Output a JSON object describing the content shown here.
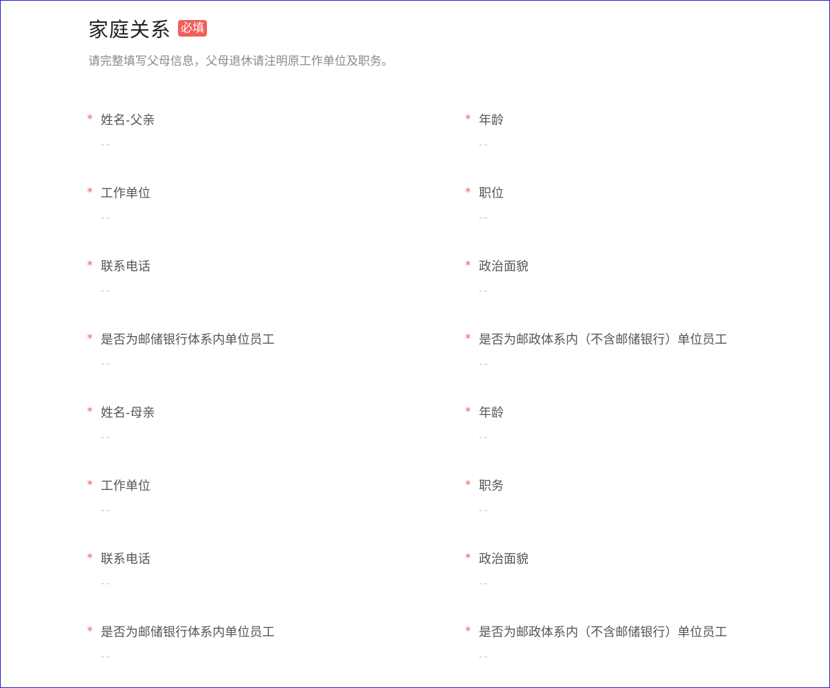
{
  "section": {
    "title": "家庭关系",
    "badge": "必填",
    "subtitle": "请完整填写父母信息，父母退休请注明原工作单位及职务。",
    "required_mark": "*"
  },
  "fields": [
    {
      "label": "姓名-父亲",
      "value": "--"
    },
    {
      "label": "年龄",
      "value": "--"
    },
    {
      "label": "工作单位",
      "value": "--"
    },
    {
      "label": "职位",
      "value": "--"
    },
    {
      "label": "联系电话",
      "value": "--"
    },
    {
      "label": "政治面貌",
      "value": "--"
    },
    {
      "label": "是否为邮储银行体系内单位员工",
      "value": "--"
    },
    {
      "label": "是否为邮政体系内（不含邮储银行）单位员工",
      "value": "--"
    },
    {
      "label": "姓名-母亲",
      "value": "--"
    },
    {
      "label": "年龄",
      "value": "--"
    },
    {
      "label": "工作单位",
      "value": "--"
    },
    {
      "label": "职务",
      "value": "--"
    },
    {
      "label": "联系电话",
      "value": "--"
    },
    {
      "label": "政治面貌",
      "value": "--"
    },
    {
      "label": "是否为邮储银行体系内单位员工",
      "value": "--"
    },
    {
      "label": "是否为邮政体系内（不含邮储银行）单位员工",
      "value": "--"
    }
  ],
  "colors": {
    "accent": "#f0605a",
    "border": "#1f1fd6"
  }
}
